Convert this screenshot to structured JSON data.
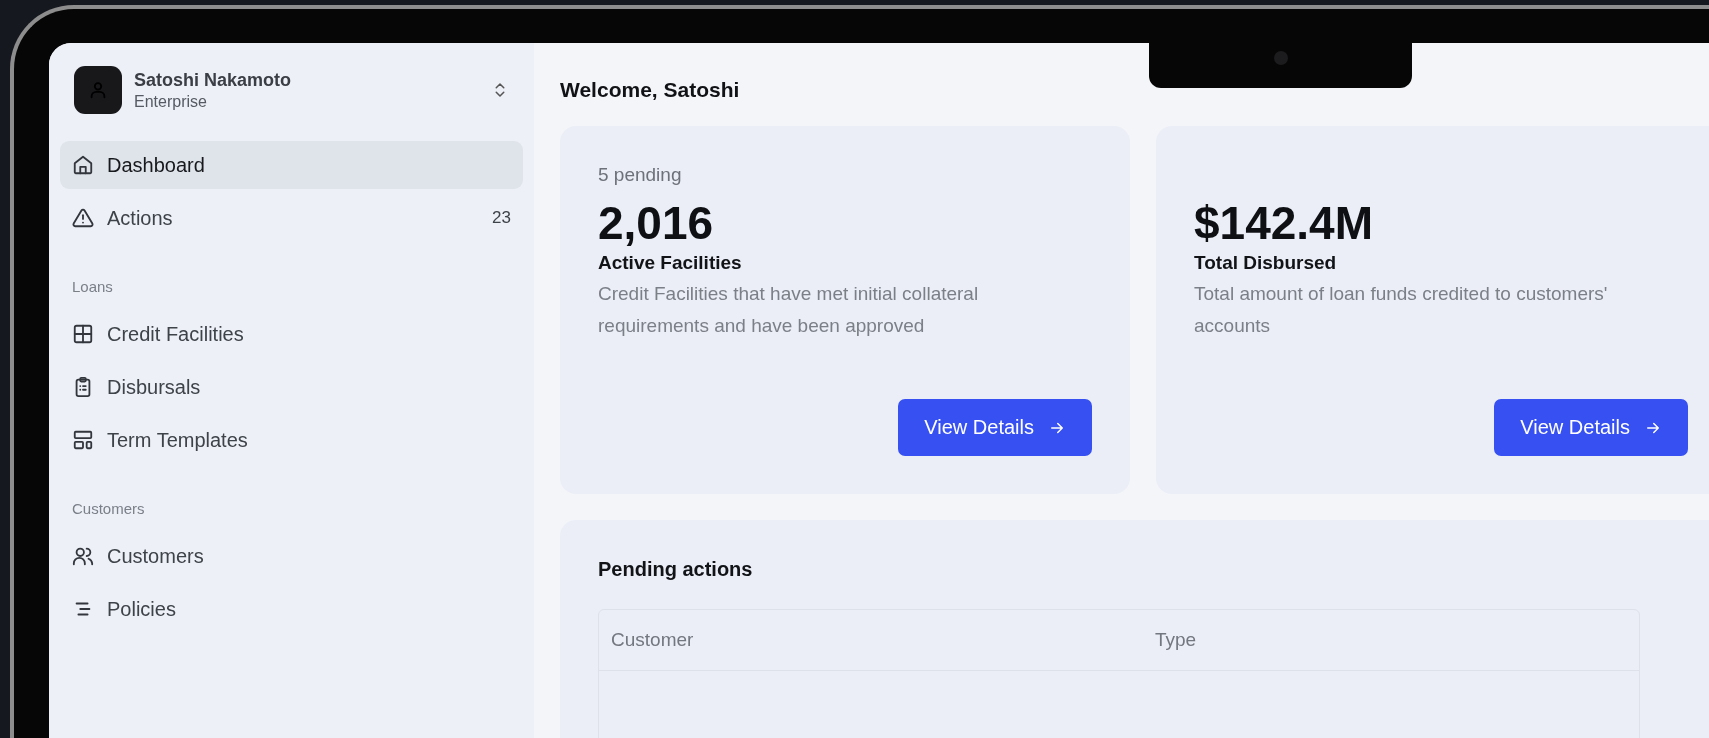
{
  "profile": {
    "name": "Satoshi Nakamoto",
    "plan": "Enterprise"
  },
  "sidebar": {
    "sections": [
      {
        "items": [
          {
            "label": "Dashboard",
            "selected": true
          },
          {
            "label": "Actions",
            "selected": false,
            "count": "23"
          }
        ]
      },
      {
        "label": "Loans",
        "items": [
          {
            "label": "Credit Facilities",
            "selected": false
          },
          {
            "label": "Disbursals",
            "selected": false
          },
          {
            "label": "Term Templates",
            "selected": false
          }
        ]
      },
      {
        "label": "Customers",
        "items": [
          {
            "label": "Customers",
            "selected": false
          },
          {
            "label": "Policies",
            "selected": false
          }
        ]
      }
    ]
  },
  "welcome": "Welcome, Satoshi",
  "cards": [
    {
      "pending": "5 pending",
      "value": "2,016",
      "title": "Active Facilities",
      "description": "Credit Facilities that have met initial collateral requirements and have been approved",
      "button": "View Details"
    },
    {
      "value": "$142.4M",
      "title": "Total Disbursed",
      "description": "Total amount of loan funds credited to customers' accounts",
      "button": "View Details"
    }
  ],
  "pending_actions": {
    "title": "Pending actions",
    "columns": [
      "Customer",
      "Type"
    ]
  }
}
